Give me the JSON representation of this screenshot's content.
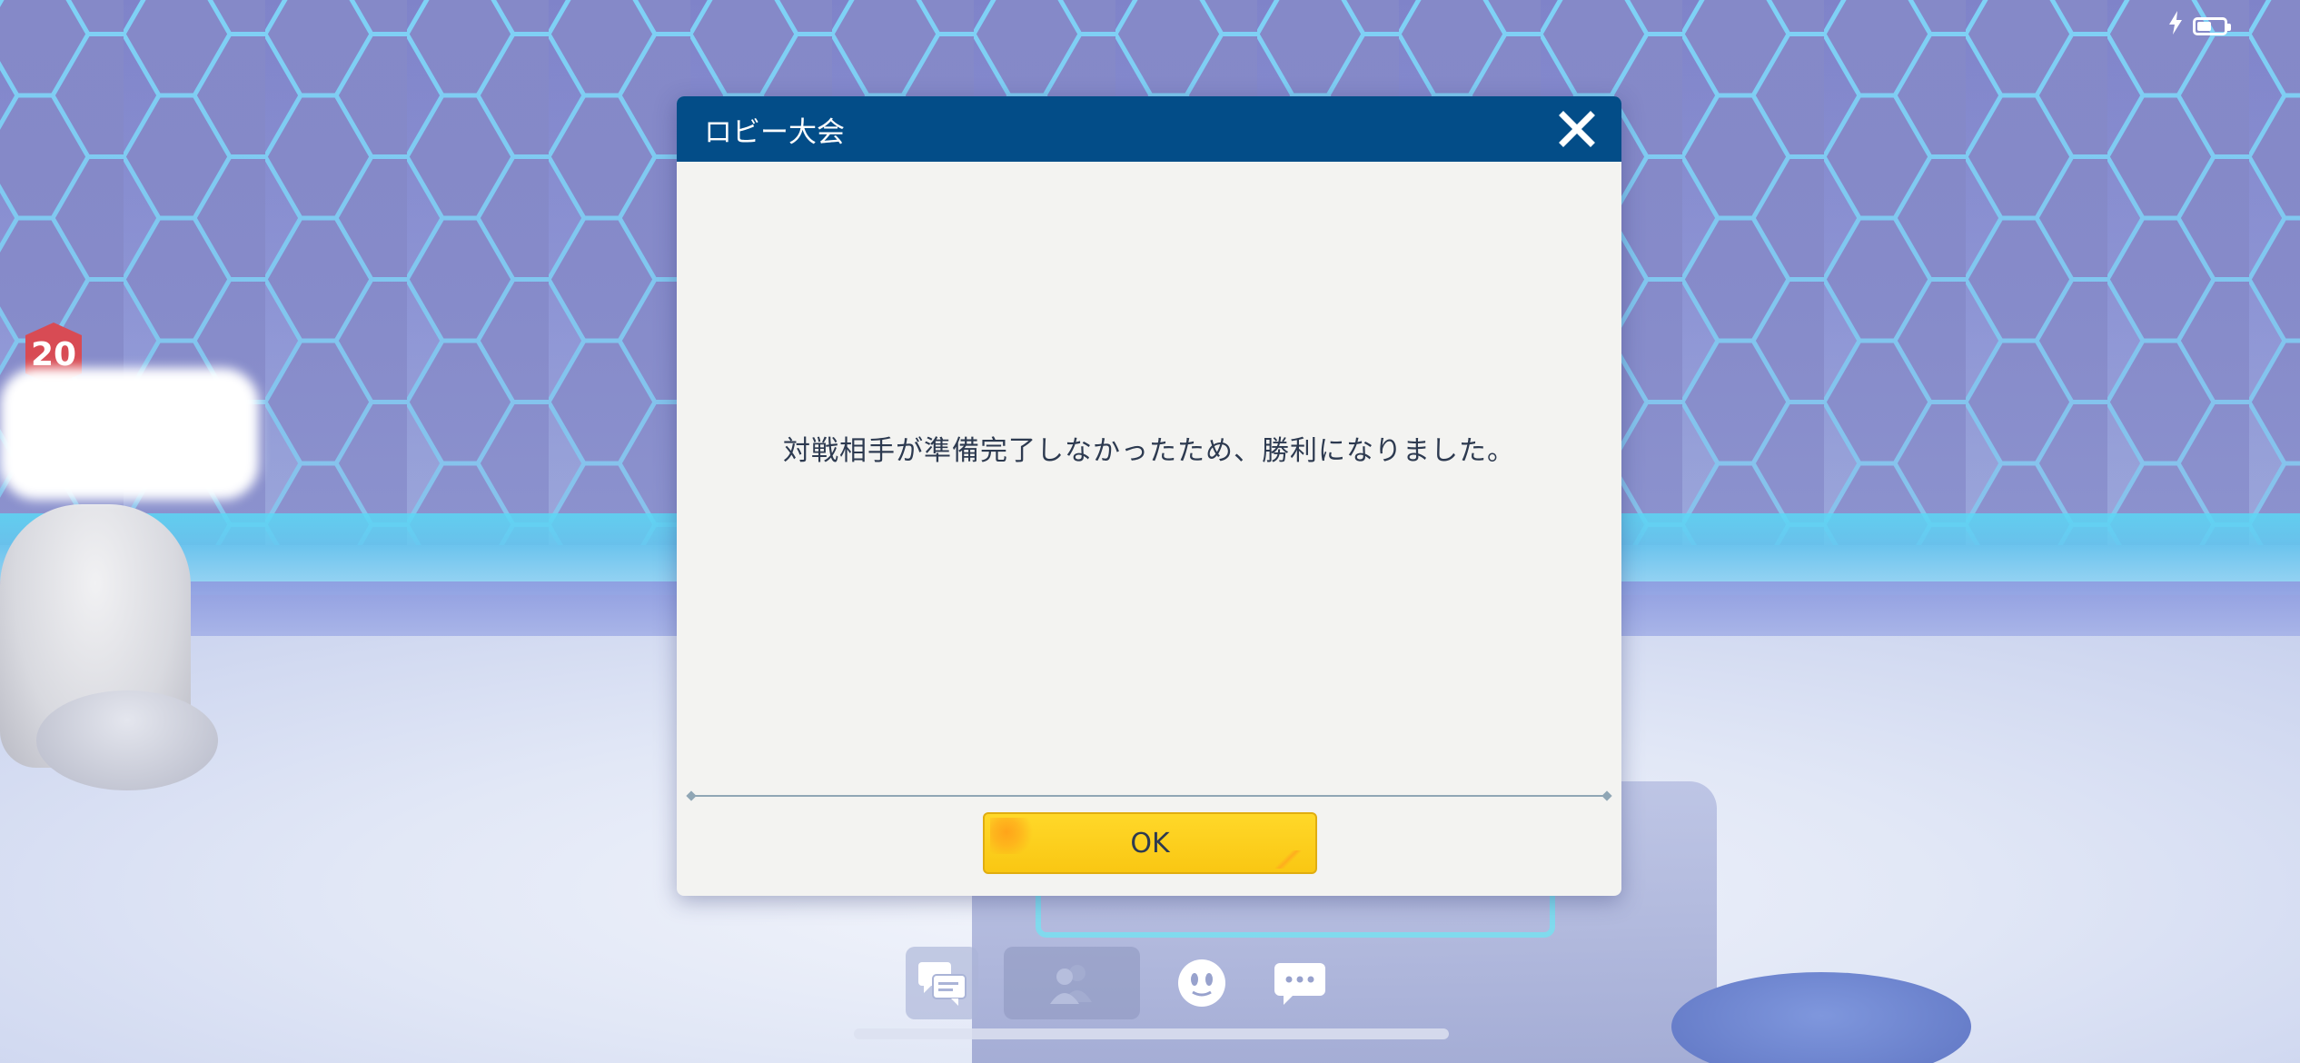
{
  "status_bar": {
    "charging_icon": "bolt-icon",
    "battery_icon": "battery-icon",
    "battery_level": 0.55
  },
  "player": {
    "level": "20"
  },
  "dialog": {
    "title": "ロビー大会",
    "message": "対戦相手が準備完了しなかったため、勝利になりました。",
    "ok_label": "OK",
    "close_icon": "close-icon"
  },
  "toolbar": {
    "items": [
      {
        "name": "chat-log",
        "icon": "chat-bubbles-icon"
      },
      {
        "name": "friends",
        "icon": "people-icon"
      },
      {
        "name": "emote",
        "icon": "face-icon"
      },
      {
        "name": "message",
        "icon": "speech-dots-icon"
      }
    ]
  },
  "colors": {
    "header": "#034d88",
    "ok_button": "#ffd829",
    "text": "#2d3a50",
    "dialog_bg": "#f3f3f1"
  }
}
